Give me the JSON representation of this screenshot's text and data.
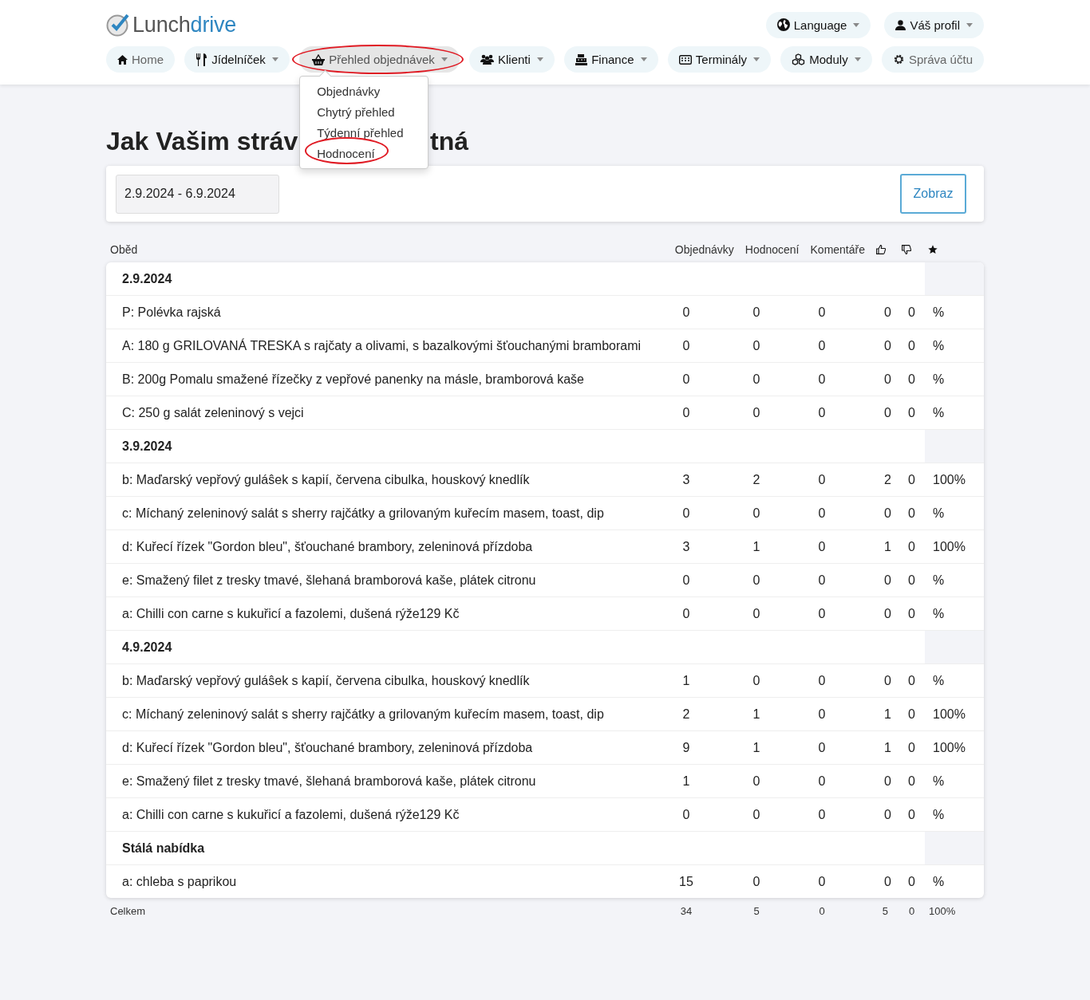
{
  "logo": {
    "text_1": "Lunch",
    "text_2": "drive"
  },
  "top_links": [
    {
      "label": "Language",
      "dropdown": true
    },
    {
      "label": "Váš profil",
      "dropdown": true
    }
  ],
  "nav": [
    {
      "label": "Home",
      "dimmed": true,
      "dropdown": false,
      "selected": false,
      "circled": false
    },
    {
      "label": "Jídelníček",
      "dimmed": false,
      "dropdown": true,
      "selected": false,
      "circled": false
    },
    {
      "label": "Přehled objednávek",
      "dimmed": false,
      "dropdown": true,
      "selected": true,
      "circled": true,
      "menu": {
        "items": [
          {
            "label": "Objednávky",
            "circled": false
          },
          {
            "label": "Chytrý přehled",
            "circled": false
          },
          {
            "label": "Týdenní přehled",
            "circled": false
          },
          {
            "label": "Hodnocení",
            "circled": true
          }
        ]
      }
    },
    {
      "label": "Klienti",
      "dimmed": false,
      "dropdown": true,
      "selected": false,
      "circled": false
    },
    {
      "label": "Finance",
      "dimmed": false,
      "dropdown": true,
      "selected": false,
      "circled": false
    },
    {
      "label": "Terminály",
      "dimmed": false,
      "dropdown": true,
      "selected": false,
      "circled": false
    },
    {
      "label": "Moduly",
      "dimmed": false,
      "dropdown": true,
      "selected": false,
      "circled": false
    },
    {
      "label": "Správa účtu",
      "dimmed": true,
      "dropdown": false,
      "selected": false,
      "circled": false
    }
  ],
  "title": {
    "left": "Jak Vašim stráv",
    "right": "tná"
  },
  "filter": {
    "date_range": "2.9.2024 - 6.9.2024",
    "button": "Zobraz"
  },
  "table": {
    "columns": [
      "Oběd",
      "Objednávky",
      "Hodnocení",
      "Komentáře"
    ],
    "rows": [
      {
        "kind": "group",
        "label": "2.9.2024"
      },
      {
        "kind": "dish",
        "name": "P: Polévka rajská",
        "orders": "0",
        "ratings": "0",
        "comments": "0",
        "likes": "0",
        "dislikes": "0",
        "percent": "%"
      },
      {
        "kind": "dish",
        "name": "A: 180 g GRILOVANÁ TRESKA s rajčaty a olivami, s bazalkovými šťouchanými bramborami",
        "orders": "0",
        "ratings": "0",
        "comments": "0",
        "likes": "0",
        "dislikes": "0",
        "percent": "%"
      },
      {
        "kind": "dish",
        "name": "B: 200g Pomalu smažené řízečky z vepřové panenky na másle, bramborová kaše",
        "orders": "0",
        "ratings": "0",
        "comments": "0",
        "likes": "0",
        "dislikes": "0",
        "percent": "%"
      },
      {
        "kind": "dish",
        "name": "C: 250 g salát zeleninový s vejci",
        "orders": "0",
        "ratings": "0",
        "comments": "0",
        "likes": "0",
        "dislikes": "0",
        "percent": "%"
      },
      {
        "kind": "group",
        "label": "3.9.2024"
      },
      {
        "kind": "dish",
        "name": "b: Maďarský vepřový guláŝek s kapií, červena cibulka, houskový knedlík",
        "orders": "3",
        "ratings": "2",
        "comments": "0",
        "likes": "2",
        "dislikes": "0",
        "percent": "100%"
      },
      {
        "kind": "dish",
        "name": "c: Míchaný zeleninový salát s sherry rajčátky a grilovaným kuřecím masem, toast, dip",
        "orders": "0",
        "ratings": "0",
        "comments": "0",
        "likes": "0",
        "dislikes": "0",
        "percent": "%"
      },
      {
        "kind": "dish",
        "name": "d: Kuřecí řízek \"Gordon bleu\", šťouchané brambory, zeleninová přízdoba",
        "orders": "3",
        "ratings": "1",
        "comments": "0",
        "likes": "1",
        "dislikes": "0",
        "percent": "100%"
      },
      {
        "kind": "dish",
        "name": "e: Smažený filet z tresky tmavé, šlehaná bramborová kaše, plátek citronu",
        "orders": "0",
        "ratings": "0",
        "comments": "0",
        "likes": "0",
        "dislikes": "0",
        "percent": "%"
      },
      {
        "kind": "dish",
        "name": "a: Chilli con carne s kukuřicí a fazolemi, dušená rýže129 Kč",
        "orders": "0",
        "ratings": "0",
        "comments": "0",
        "likes": "0",
        "dislikes": "0",
        "percent": "%"
      },
      {
        "kind": "group",
        "label": "4.9.2024"
      },
      {
        "kind": "dish",
        "name": "b: Maďarský vepřový guláŝek s kapií, červena cibulka, houskový knedlík",
        "orders": "1",
        "ratings": "0",
        "comments": "0",
        "likes": "0",
        "dislikes": "0",
        "percent": "%"
      },
      {
        "kind": "dish",
        "name": "c: Míchaný zeleninový salát s sherry rajčátky a grilovaným kuřecím masem, toast, dip",
        "orders": "2",
        "ratings": "1",
        "comments": "0",
        "likes": "1",
        "dislikes": "0",
        "percent": "100%"
      },
      {
        "kind": "dish",
        "name": "d: Kuřecí řízek \"Gordon bleu\", šťouchané brambory, zeleninová přízdoba",
        "orders": "9",
        "ratings": "1",
        "comments": "0",
        "likes": "1",
        "dislikes": "0",
        "percent": "100%"
      },
      {
        "kind": "dish",
        "name": "e: Smažený filet z tresky tmavé, šlehaná bramborová kaše, plátek citronu",
        "orders": "1",
        "ratings": "0",
        "comments": "0",
        "likes": "0",
        "dislikes": "0",
        "percent": "%"
      },
      {
        "kind": "dish",
        "name": "a: Chilli con carne s kukuřicí a fazolemi, dušená rýže129 Kč",
        "orders": "0",
        "ratings": "0",
        "comments": "0",
        "likes": "0",
        "dislikes": "0",
        "percent": "%"
      },
      {
        "kind": "group",
        "label": "Stálá nabídka"
      },
      {
        "kind": "dish",
        "name": "a: chleba s paprikou",
        "orders": "15",
        "ratings": "0",
        "comments": "0",
        "likes": "0",
        "dislikes": "0",
        "percent": "%"
      }
    ],
    "totals": {
      "label": "Celkem",
      "orders": "34",
      "ratings": "5",
      "comments": "0",
      "likes": "5",
      "dislikes": "0",
      "percent": "100%"
    }
  }
}
